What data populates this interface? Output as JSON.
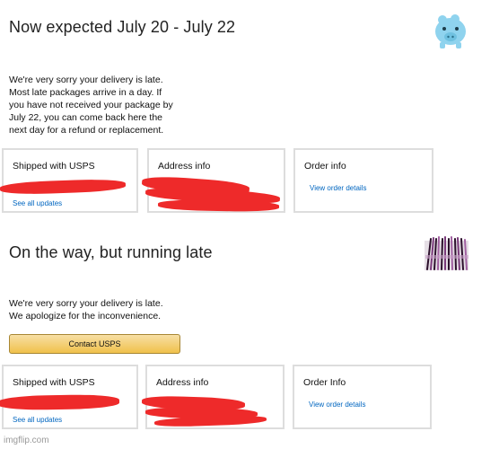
{
  "colors": {
    "link": "#0066c0",
    "button_top": "#f7dfa5",
    "button_bottom": "#f0c14b",
    "redaction": "#ee2a2a",
    "card_border": "#dddddd"
  },
  "panels": [
    {
      "title": "Now expected July 20 - July 22",
      "message_lines": [
        "We're very sorry your delivery is late.",
        "Most late packages arrive in a day. If",
        "you have not received your package by",
        "July 22, you can come back here the",
        "next day for a refund or replacement."
      ],
      "shipped": {
        "title": "Shipped with USPS",
        "link": "See all updates"
      },
      "address": {
        "title": "Address info"
      },
      "order": {
        "title": "Order info",
        "link": "View order details"
      },
      "image_icon": "piggy-bank-icon"
    },
    {
      "title": "On the way, but running late",
      "message_lines": [
        "We're very sorry your delivery is late.",
        "We apologize for the inconvenience."
      ],
      "button": "Contact USPS",
      "shipped": {
        "title": "Shipped with USPS",
        "link": "See all updates"
      },
      "address": {
        "title": "Address info"
      },
      "order": {
        "title": "Order Info",
        "link": "View order details"
      },
      "image_icon": "makeup-brushes-icon"
    }
  ],
  "watermark": "imgflip.com"
}
